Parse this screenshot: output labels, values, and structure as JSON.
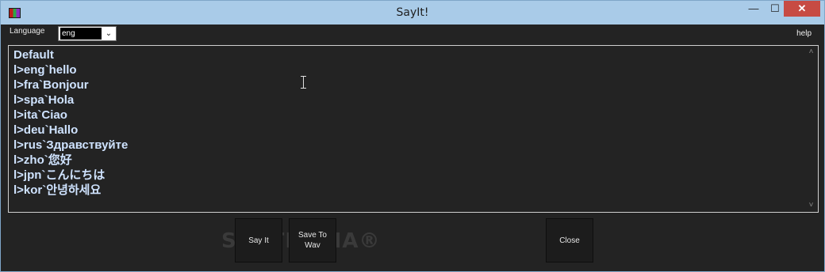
{
  "window": {
    "title": "SayIt!",
    "minimize_glyph": "—",
    "maximize_glyph": "☐",
    "close_glyph": "✕",
    "icon": "app-icon"
  },
  "toolbar": {
    "language_label": "Language",
    "language_value": "eng",
    "dropdown_glyph": "⌄",
    "help_label": "help"
  },
  "editor": {
    "lines": [
      "Default",
      "l>eng`hello",
      "l>fra`Bonjour",
      "l>spa`Hola",
      "l>ita`Ciao",
      "l>deu`Hallo",
      "l>rus`Здравствуйте",
      "l>zho`您好",
      "l>jpn`こんにちは",
      "l>kor`안녕하세요"
    ],
    "scroll_up_glyph": "˄",
    "scroll_down_glyph": "˅"
  },
  "buttons": {
    "say_it": "Say It",
    "save_to_wav": "Save To Wav",
    "close": "Close"
  },
  "watermark": "SOFTPEDIA®"
}
